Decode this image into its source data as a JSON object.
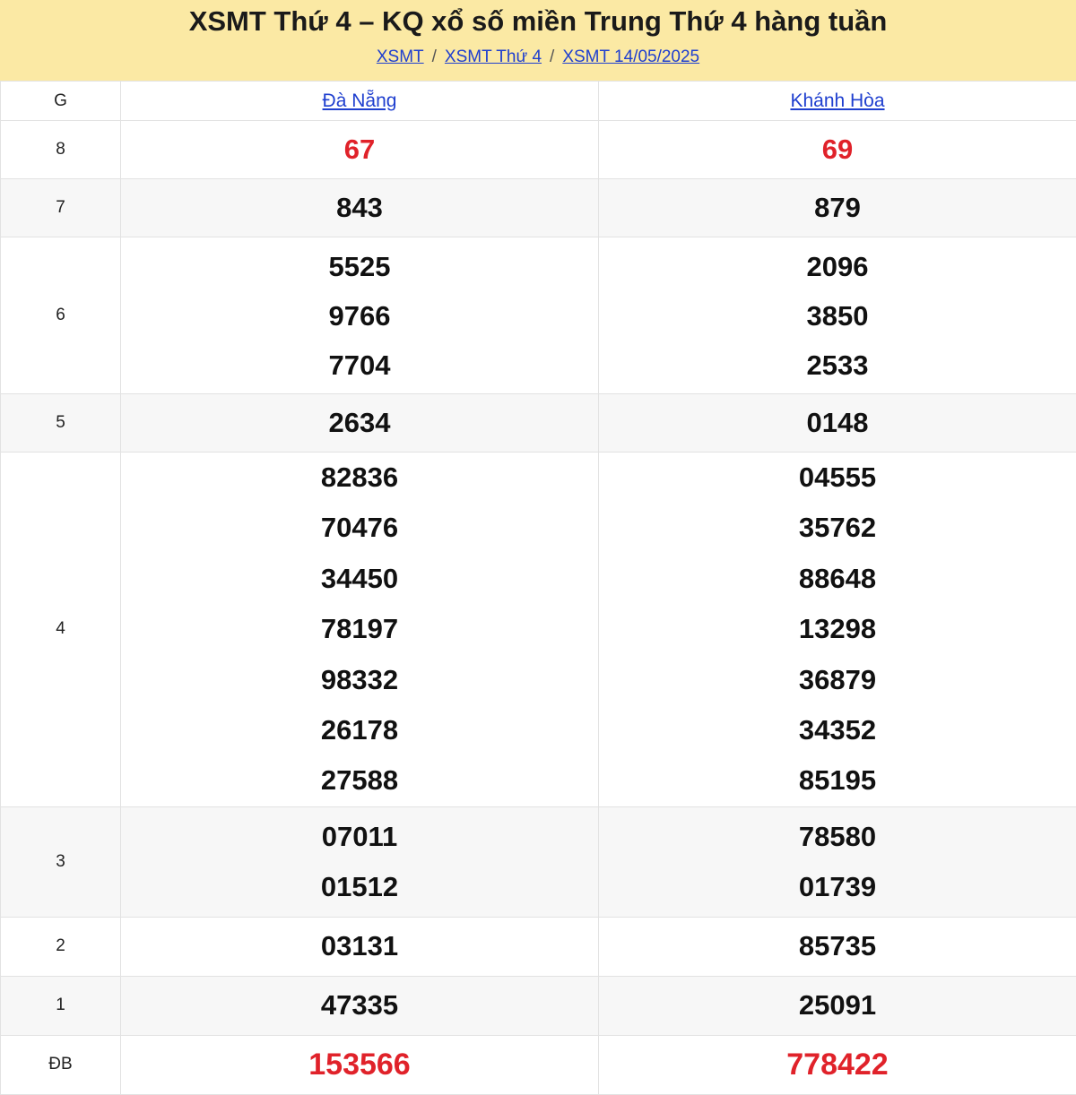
{
  "header": {
    "title": "XSMT Thứ 4 – KQ xổ số miền Trung Thứ 4 hàng tuần",
    "breadcrumb": [
      "XSMT",
      "XSMT Thứ 4",
      "XSMT 14/05/2025"
    ],
    "separator": "/"
  },
  "table": {
    "col_g": "G",
    "provinces": [
      "Đà Nẵng",
      "Khánh Hòa"
    ],
    "rows": [
      {
        "g": "8",
        "a": [
          "67"
        ],
        "b": [
          "69"
        ]
      },
      {
        "g": "7",
        "a": [
          "843"
        ],
        "b": [
          "879"
        ]
      },
      {
        "g": "6",
        "a": [
          "5525",
          "9766",
          "7704"
        ],
        "b": [
          "2096",
          "3850",
          "2533"
        ]
      },
      {
        "g": "5",
        "a": [
          "2634"
        ],
        "b": [
          "0148"
        ]
      },
      {
        "g": "4",
        "a": [
          "82836",
          "70476",
          "34450",
          "78197",
          "98332",
          "26178",
          "27588"
        ],
        "b": [
          "04555",
          "35762",
          "88648",
          "13298",
          "36879",
          "34352",
          "85195"
        ]
      },
      {
        "g": "3",
        "a": [
          "07011",
          "01512"
        ],
        "b": [
          "78580",
          "01739"
        ]
      },
      {
        "g": "2",
        "a": [
          "03131"
        ],
        "b": [
          "85735"
        ]
      },
      {
        "g": "1",
        "a": [
          "47335"
        ],
        "b": [
          "25091"
        ]
      },
      {
        "g": "ĐB",
        "a": [
          "153566"
        ],
        "b": [
          "778422"
        ]
      }
    ]
  },
  "colors": {
    "header_bg": "#fbe9a4",
    "link": "#1f3fcf",
    "highlight": "#e0222a"
  }
}
